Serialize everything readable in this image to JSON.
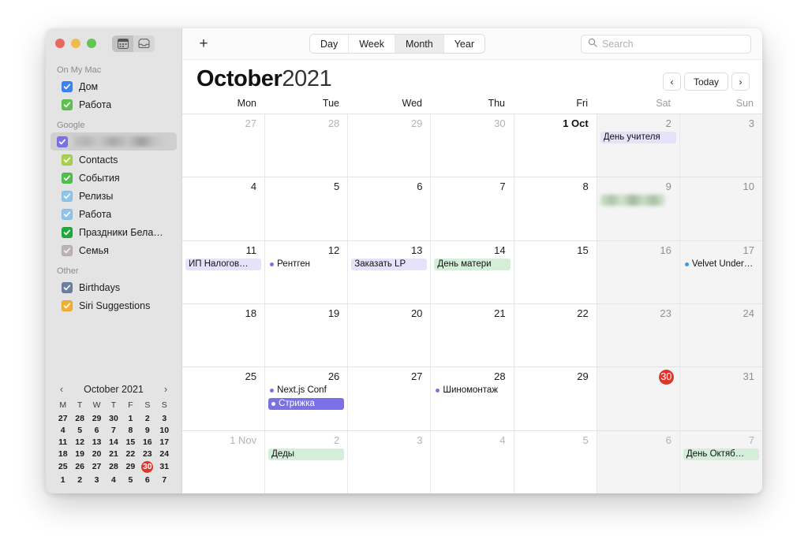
{
  "window": {
    "traffic_lights": [
      "close",
      "minimize",
      "zoom"
    ],
    "view_toggle": [
      {
        "name": "calendar-icon",
        "active": true
      },
      {
        "name": "inbox-icon",
        "active": false
      }
    ]
  },
  "sidebar": {
    "sections": [
      {
        "title": "On My Mac",
        "items": [
          {
            "label": "Дом",
            "color": "#3b82f6",
            "checked": true,
            "selected": false,
            "redacted": false
          },
          {
            "label": "Работа",
            "color": "#5fc24e",
            "checked": true,
            "selected": false,
            "redacted": false
          }
        ]
      },
      {
        "title": "Google",
        "items": [
          {
            "label": "",
            "color": "#7b72e8",
            "checked": true,
            "selected": true,
            "redacted": true
          },
          {
            "label": "Contacts",
            "color": "#a8d24d",
            "checked": true,
            "selected": false,
            "redacted": false
          },
          {
            "label": "События",
            "color": "#4fc04a",
            "checked": true,
            "selected": false,
            "redacted": false
          },
          {
            "label": "Релизы",
            "color": "#8fc4ec",
            "checked": true,
            "selected": false,
            "redacted": false
          },
          {
            "label": "Работа",
            "color": "#8fc4ec",
            "checked": true,
            "selected": false,
            "redacted": false
          },
          {
            "label": "Праздники Бела…",
            "color": "#21a93f",
            "checked": true,
            "selected": false,
            "redacted": false
          },
          {
            "label": "Семья",
            "color": "#bdb2b2",
            "checked": true,
            "selected": false,
            "redacted": false
          }
        ]
      },
      {
        "title": "Other",
        "items": [
          {
            "label": "Birthdays",
            "color": "#6d7f9e",
            "checked": true,
            "selected": false,
            "redacted": false
          },
          {
            "label": "Siri Suggestions",
            "color": "#f2b02c",
            "checked": true,
            "selected": false,
            "redacted": false
          }
        ]
      }
    ]
  },
  "mini_calendar": {
    "title": "October 2021",
    "prev_icon": "chevron-left-icon",
    "next_icon": "chevron-right-icon",
    "weekday_headers": [
      "M",
      "T",
      "W",
      "T",
      "F",
      "S",
      "S"
    ],
    "weeks": [
      [
        {
          "d": "27",
          "o": true
        },
        {
          "d": "28",
          "o": true
        },
        {
          "d": "29",
          "o": true
        },
        {
          "d": "30",
          "o": true
        },
        {
          "d": "1"
        },
        {
          "d": "2",
          "w": true
        },
        {
          "d": "3",
          "w": true
        }
      ],
      [
        {
          "d": "4"
        },
        {
          "d": "5"
        },
        {
          "d": "6"
        },
        {
          "d": "7"
        },
        {
          "d": "8"
        },
        {
          "d": "9",
          "w": true
        },
        {
          "d": "10",
          "w": true
        }
      ],
      [
        {
          "d": "11"
        },
        {
          "d": "12"
        },
        {
          "d": "13"
        },
        {
          "d": "14"
        },
        {
          "d": "15"
        },
        {
          "d": "16",
          "w": true
        },
        {
          "d": "17",
          "w": true
        }
      ],
      [
        {
          "d": "18"
        },
        {
          "d": "19"
        },
        {
          "d": "20"
        },
        {
          "d": "21"
        },
        {
          "d": "22"
        },
        {
          "d": "23",
          "w": true
        },
        {
          "d": "24",
          "w": true
        }
      ],
      [
        {
          "d": "25"
        },
        {
          "d": "26"
        },
        {
          "d": "27"
        },
        {
          "d": "28"
        },
        {
          "d": "29"
        },
        {
          "d": "30",
          "w": true,
          "today": true
        },
        {
          "d": "31",
          "w": true
        }
      ],
      [
        {
          "d": "1",
          "o": true
        },
        {
          "d": "2",
          "o": true
        },
        {
          "d": "3",
          "o": true
        },
        {
          "d": "4",
          "o": true
        },
        {
          "d": "5",
          "o": true
        },
        {
          "d": "6",
          "o": true,
          "w": true
        },
        {
          "d": "7",
          "o": true,
          "w": true
        }
      ]
    ]
  },
  "toolbar": {
    "add_label": "+",
    "views": [
      {
        "label": "Day",
        "active": false
      },
      {
        "label": "Week",
        "active": false
      },
      {
        "label": "Month",
        "active": true
      },
      {
        "label": "Year",
        "active": false
      }
    ],
    "search_placeholder": "Search",
    "search_value": "",
    "search_icon": "search-icon"
  },
  "header": {
    "month": "October",
    "year": "2021",
    "prev_label": "‹",
    "today_label": "Today",
    "next_label": "›"
  },
  "weekday_headers": [
    {
      "label": "Mon",
      "weekend": false
    },
    {
      "label": "Tue",
      "weekend": false
    },
    {
      "label": "Wed",
      "weekend": false
    },
    {
      "label": "Thu",
      "weekend": false
    },
    {
      "label": "Fri",
      "weekend": false
    },
    {
      "label": "Sat",
      "weekend": true
    },
    {
      "label": "Sun",
      "weekend": true
    }
  ],
  "accent_colors": {
    "today_red": "#e0352b",
    "event_purple_bg": "#e5e3f9",
    "event_green_bg": "#d5eed9",
    "event_selected_purple": "#7a71e8",
    "dot_purple": "#7b72e8",
    "dot_blue": "#3b9ae1",
    "weekend_bg": "#f4f4f4"
  },
  "weeks": [
    [
      {
        "num": "27",
        "other": true,
        "weekend": false,
        "events": []
      },
      {
        "num": "28",
        "other": true,
        "weekend": false,
        "events": []
      },
      {
        "num": "29",
        "other": true,
        "weekend": false,
        "events": []
      },
      {
        "num": "30",
        "other": true,
        "weekend": false,
        "events": []
      },
      {
        "num": "1 Oct",
        "bold": true,
        "weekend": false,
        "events": []
      },
      {
        "num": "2",
        "weekend": true,
        "events": [
          {
            "title": "День учителя",
            "style": "pill-purple"
          }
        ]
      },
      {
        "num": "3",
        "weekend": true,
        "events": []
      }
    ],
    [
      {
        "num": "4",
        "weekend": false,
        "events": []
      },
      {
        "num": "5",
        "weekend": false,
        "events": []
      },
      {
        "num": "6",
        "weekend": false,
        "events": []
      },
      {
        "num": "7",
        "weekend": false,
        "events": []
      },
      {
        "num": "8",
        "weekend": false,
        "events": []
      },
      {
        "num": "9",
        "weekend": true,
        "events": [
          {
            "title": "",
            "style": "blurred-green"
          }
        ]
      },
      {
        "num": "10",
        "weekend": true,
        "events": []
      }
    ],
    [
      {
        "num": "11",
        "weekend": false,
        "events": [
          {
            "title": "ИП Налогов…",
            "style": "pill-purple"
          }
        ]
      },
      {
        "num": "12",
        "weekend": false,
        "events": [
          {
            "title": "Рентген",
            "style": "plain",
            "dot": "#7b72e8"
          }
        ]
      },
      {
        "num": "13",
        "weekend": false,
        "events": [
          {
            "title": "Заказать LP",
            "style": "pill-purple"
          }
        ]
      },
      {
        "num": "14",
        "weekend": false,
        "events": [
          {
            "title": "День матери",
            "style": "pill-green"
          }
        ]
      },
      {
        "num": "15",
        "weekend": false,
        "events": []
      },
      {
        "num": "16",
        "weekend": true,
        "events": []
      },
      {
        "num": "17",
        "weekend": true,
        "events": [
          {
            "title": "Velvet Under…",
            "style": "plain",
            "dot": "#3b9ae1"
          }
        ]
      }
    ],
    [
      {
        "num": "18",
        "weekend": false,
        "events": []
      },
      {
        "num": "19",
        "weekend": false,
        "events": []
      },
      {
        "num": "20",
        "weekend": false,
        "events": []
      },
      {
        "num": "21",
        "weekend": false,
        "events": []
      },
      {
        "num": "22",
        "weekend": false,
        "events": []
      },
      {
        "num": "23",
        "weekend": true,
        "events": []
      },
      {
        "num": "24",
        "weekend": true,
        "events": []
      }
    ],
    [
      {
        "num": "25",
        "weekend": false,
        "events": []
      },
      {
        "num": "26",
        "weekend": false,
        "events": [
          {
            "title": "Next.js Conf",
            "style": "plain",
            "dot": "#7b72e8"
          },
          {
            "title": "Стрижка",
            "style": "sel-purple",
            "dot": "#ffffff"
          }
        ]
      },
      {
        "num": "27",
        "weekend": false,
        "events": []
      },
      {
        "num": "28",
        "weekend": false,
        "events": [
          {
            "title": "Шиномонтаж",
            "style": "plain",
            "dot": "#7b72e8"
          }
        ]
      },
      {
        "num": "29",
        "weekend": false,
        "events": []
      },
      {
        "num": "30",
        "weekend": true,
        "today": true,
        "events": []
      },
      {
        "num": "31",
        "weekend": true,
        "events": []
      }
    ],
    [
      {
        "num": "1 Nov",
        "other": true,
        "weekend": false,
        "events": []
      },
      {
        "num": "2",
        "other": true,
        "weekend": false,
        "events": [
          {
            "title": "Деды",
            "style": "pill-green"
          }
        ]
      },
      {
        "num": "3",
        "other": true,
        "weekend": false,
        "events": []
      },
      {
        "num": "4",
        "other": true,
        "weekend": false,
        "events": []
      },
      {
        "num": "5",
        "other": true,
        "weekend": false,
        "events": []
      },
      {
        "num": "6",
        "other": true,
        "weekend": true,
        "events": []
      },
      {
        "num": "7",
        "other": true,
        "weekend": true,
        "events": [
          {
            "title": "День Октяб…",
            "style": "pill-green"
          }
        ]
      }
    ]
  ]
}
